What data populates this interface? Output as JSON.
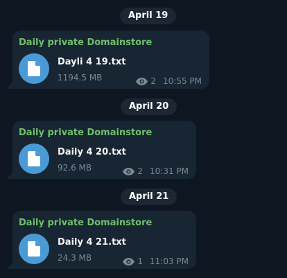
{
  "colors": {
    "background": "#0e1621",
    "bubble": "#182533",
    "date_pill": "#1c2733",
    "sender": "#6fc06a",
    "file_icon": "#4a9ad6",
    "muted_text": "#7c8894"
  },
  "messages": [
    {
      "date": "April 19",
      "sender": "Daily private Domainstore",
      "file_icon": "document-icon",
      "file_name": "Dayli 4 19.txt",
      "file_size": "1194.5 MB",
      "views_icon": "eye-icon",
      "views": "2",
      "time": "10:55 PM"
    },
    {
      "date": "April 20",
      "sender": "Daily private Domainstore",
      "file_icon": "document-icon",
      "file_name": "Daily 4 20.txt",
      "file_size": "92.6 MB",
      "views_icon": "eye-icon",
      "views": "2",
      "time": "10:31 PM"
    },
    {
      "date": "April 21",
      "sender": "Daily private Domainstore",
      "file_icon": "document-icon",
      "file_name": "Daily 4 21.txt",
      "file_size": "24.3 MB",
      "views_icon": "eye-icon",
      "views": "1",
      "time": "11:03 PM"
    }
  ]
}
